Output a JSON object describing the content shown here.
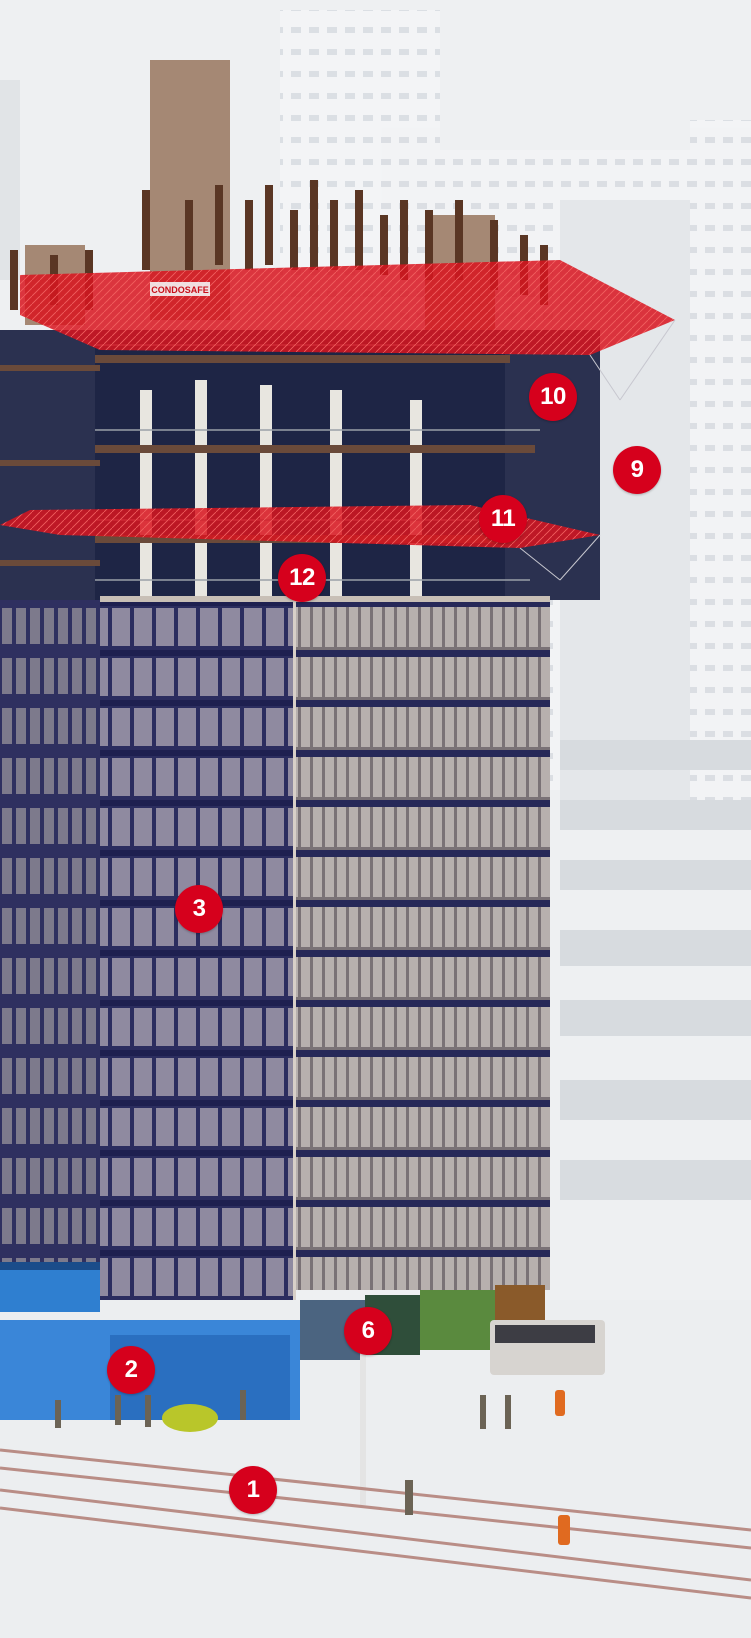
{
  "markers": [
    {
      "label": "1"
    },
    {
      "label": "2"
    },
    {
      "label": "3"
    },
    {
      "label": "6"
    },
    {
      "label": "9"
    },
    {
      "label": "10"
    },
    {
      "label": "11"
    },
    {
      "label": "12"
    }
  ],
  "net_banner": "CONDOSAFE",
  "colors": {
    "marker": "#d6001c",
    "safety_net": "#d8141e",
    "hoarding": "#3a7ed8",
    "facade_glass": "#2a2c5e",
    "steel": "#5a3e2e",
    "sky": "#eef0f2"
  }
}
